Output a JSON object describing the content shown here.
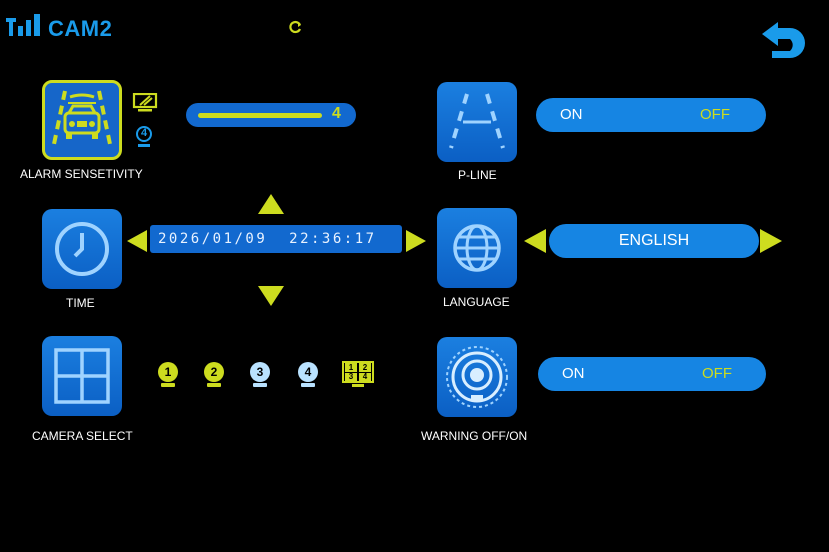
{
  "header": {
    "camera_name": "CAM2"
  },
  "alarm": {
    "label": "ALARM SENSETIVITY",
    "camera_badge": "4",
    "sensitivity_value": "4"
  },
  "pline": {
    "label": "P-LINE",
    "on_label": "ON",
    "off_label": "OFF",
    "selected": "OFF"
  },
  "time": {
    "label": "TIME",
    "datetime": "2026/01/09  22:36:17"
  },
  "language": {
    "label": "LANGUAGE",
    "value": "ENGLISH"
  },
  "camera_select": {
    "label": "CAMERA SELECT",
    "cameras": [
      "1",
      "2",
      "3",
      "4"
    ],
    "quad_labels": [
      "1",
      "2",
      "3",
      "4"
    ]
  },
  "warning": {
    "label": "WARNING OFF/ON",
    "on_label": "ON",
    "off_label": "OFF",
    "selected": "OFF"
  },
  "colors": {
    "accent_blue": "#1685e3",
    "accent_yellow": "#cddc1f",
    "background": "#000000"
  }
}
